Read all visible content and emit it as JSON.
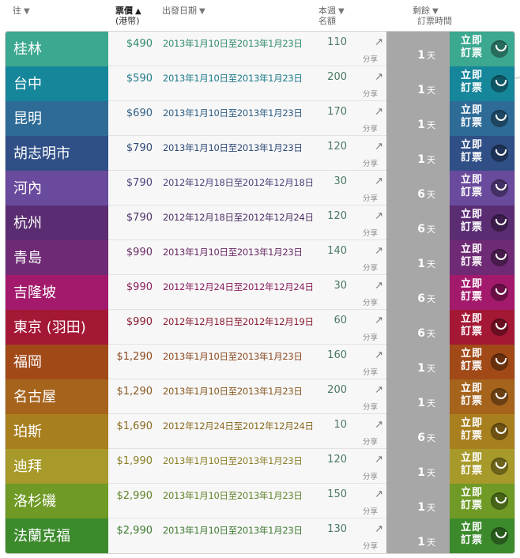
{
  "header": {
    "destination": "往",
    "price": "票價",
    "price_sort_arrow": "▲",
    "price_unit": "(港幣)",
    "date": "出發日期",
    "quota_line1": "本週",
    "quota_line2": "名額",
    "remaining_line1": "剩餘",
    "remaining_line2": "訂票時間",
    "sort_arrow": "▼"
  },
  "share_label": "分享",
  "book_label": "立即訂票",
  "day_unit": "天",
  "rows": [
    {
      "dest": "桂林",
      "price": "$490",
      "date": "2013年1月10日至2013年1月23日",
      "quota": "110",
      "days": "1",
      "color": "#3ca88f",
      "text_color": "#2f8a6f"
    },
    {
      "dest": "台中",
      "price": "$590",
      "date": "2013年1月10日至2013年1月23日",
      "quota": "200",
      "days": "1",
      "color": "#16869a",
      "text_color": "#1e7a8a"
    },
    {
      "dest": "昆明",
      "price": "$690",
      "date": "2013年1月10日至2013年1月23日",
      "quota": "170",
      "days": "1",
      "color": "#2e6c97",
      "text_color": "#2f5f86"
    },
    {
      "dest": "胡志明市",
      "price": "$790",
      "date": "2013年1月10日至2013年1月23日",
      "quota": "120",
      "days": "1",
      "color": "#2f4f86",
      "text_color": "#2f4a78"
    },
    {
      "dest": "河內",
      "price": "$790",
      "date": "2012年12月18日至2012年12月18日",
      "quota": "30",
      "days": "6",
      "color": "#6a4a9c",
      "text_color": "#4c3f7a"
    },
    {
      "dest": "杭州",
      "price": "$790",
      "date": "2012年12月18日至2012年12月24日",
      "quota": "120",
      "days": "6",
      "color": "#5a2d72",
      "text_color": "#4d2f66"
    },
    {
      "dest": "青島",
      "price": "$990",
      "date": "2013年1月10日至2013年1月23日",
      "quota": "140",
      "days": "1",
      "color": "#6e2a74",
      "text_color": "#6a2a66"
    },
    {
      "dest": "吉隆坡",
      "price": "$990",
      "date": "2012年12月24日至2012年12月24日",
      "quota": "30",
      "days": "6",
      "color": "#a31a6c",
      "text_color": "#8a2060"
    },
    {
      "dest": "東京 (羽田)",
      "price": "$990",
      "date": "2012年12月18日至2012年12月19日",
      "quota": "60",
      "days": "6",
      "color": "#a41735",
      "text_color": "#8a1a30"
    },
    {
      "dest": "福岡",
      "price": "$1,290",
      "date": "2013年1月10日至2013年1月23日",
      "quota": "160",
      "days": "1",
      "color": "#a14a18",
      "text_color": "#8a4a20"
    },
    {
      "dest": "名古屋",
      "price": "$1,290",
      "date": "2013年1月10日至2013年1月23日",
      "quota": "200",
      "days": "1",
      "color": "#a5631c",
      "text_color": "#8a5a22"
    },
    {
      "dest": "珀斯",
      "price": "$1,690",
      "date": "2012年12月24日至2012年12月24日",
      "quota": "10",
      "days": "6",
      "color": "#a87f1e",
      "text_color": "#8a6a20"
    },
    {
      "dest": "迪拜",
      "price": "$1,990",
      "date": "2013年1月10日至2013年1月23日",
      "quota": "120",
      "days": "1",
      "color": "#a89a2a",
      "text_color": "#8a7f28"
    },
    {
      "dest": "洛杉磯",
      "price": "$2,990",
      "date": "2013年1月10日至2013年1月23日",
      "quota": "150",
      "days": "1",
      "color": "#6e9a25",
      "text_color": "#5f8228"
    },
    {
      "dest": "法蘭克福",
      "price": "$2,990",
      "date": "2013年1月10日至2013年1月23日",
      "quota": "130",
      "days": "1",
      "color": "#3c8a2c",
      "text_color": "#3f7a30"
    }
  ]
}
